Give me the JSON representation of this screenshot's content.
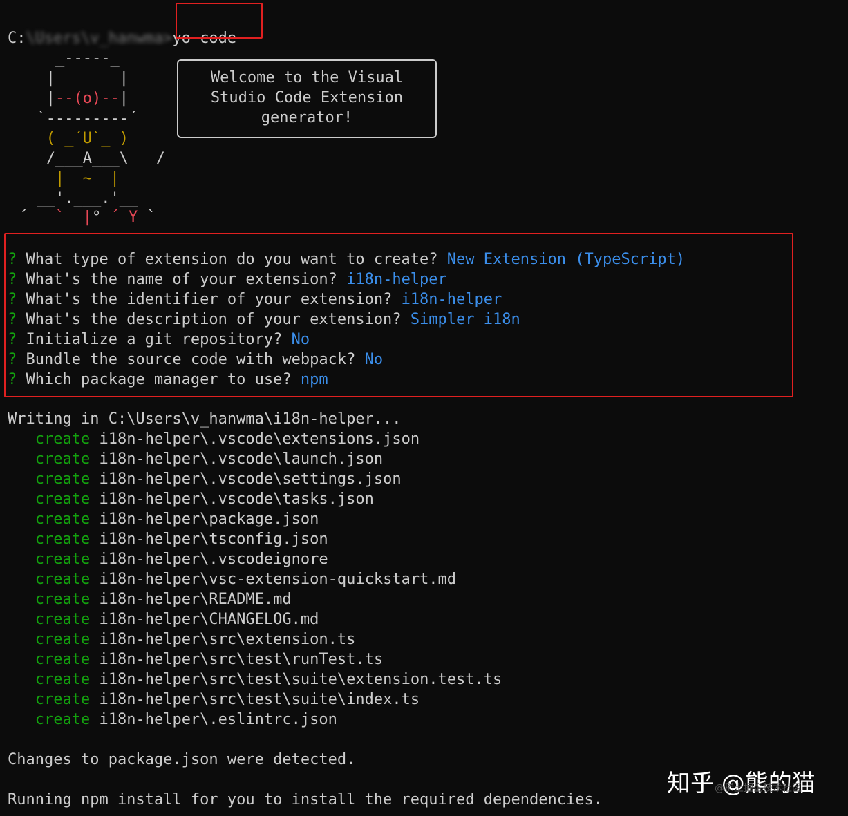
{
  "prompt_line": {
    "path_prefix": "C:",
    "path_obscured": "\\Users\\v_hanwma>",
    "command": "yo code"
  },
  "yeoman_ascii": {
    "line1": "    _-----_    ",
    "line2": "   |       |   ",
    "line3a": "   |",
    "line3b": "--(o)--",
    "line3c": "|   ",
    "line4": "  `---------´  ",
    "line5": "   ( _´U`_ )   ",
    "line6": "   /___A___\\   /",
    "line7": "    |  ~  |     ",
    "line8": "  __'.___.'__   ",
    "line9a": "´   ",
    "line9b": "`  |",
    "line9c": "° ",
    "line9d": "´ Y",
    "line9e": " `"
  },
  "welcome": {
    "line1": "Welcome to the Visual",
    "line2": "Studio Code Extension",
    "line3": "generator!"
  },
  "questions": [
    {
      "mark": "?",
      "text": "What type of extension do you want to create?",
      "answer": "New Extension (TypeScript)"
    },
    {
      "mark": "?",
      "text": "What's the name of your extension?",
      "answer": "i18n-helper"
    },
    {
      "mark": "?",
      "text": "What's the identifier of your extension?",
      "answer": "i18n-helper"
    },
    {
      "mark": "?",
      "text": "What's the description of your extension?",
      "answer": "Simpler i18n"
    },
    {
      "mark": "?",
      "text": "Initialize a git repository?",
      "answer": "No"
    },
    {
      "mark": "?",
      "text": "Bundle the source code with webpack?",
      "answer": "No"
    },
    {
      "mark": "?",
      "text": "Which package manager to use?",
      "answer": "npm"
    }
  ],
  "writing_line": "Writing in C:\\Users\\v_hanwma\\i18n-helper...",
  "create_label": "create",
  "created_files": [
    "i18n-helper\\.vscode\\extensions.json",
    "i18n-helper\\.vscode\\launch.json",
    "i18n-helper\\.vscode\\settings.json",
    "i18n-helper\\.vscode\\tasks.json",
    "i18n-helper\\package.json",
    "i18n-helper\\tsconfig.json",
    "i18n-helper\\.vscodeignore",
    "i18n-helper\\vsc-extension-quickstart.md",
    "i18n-helper\\README.md",
    "i18n-helper\\CHANGELOG.md",
    "i18n-helper\\src\\extension.ts",
    "i18n-helper\\src\\test\\runTest.ts",
    "i18n-helper\\src\\test\\suite\\extension.test.ts",
    "i18n-helper\\src\\test\\suite\\index.ts",
    "i18n-helper\\.eslintrc.json"
  ],
  "changes_line": "Changes to package.json were detected.",
  "running_line": "Running npm install for you to install the required dependencies.",
  "watermark": {
    "main": "知乎 @熊的猫",
    "sub": "@稀土掘金技术社区"
  },
  "colors": {
    "background": "#0c0c0c",
    "text": "#cccccc",
    "answer": "#3b8eea",
    "question_mark": "#13a10e",
    "create": "#13a10e",
    "highlight_box": "#e02020"
  }
}
